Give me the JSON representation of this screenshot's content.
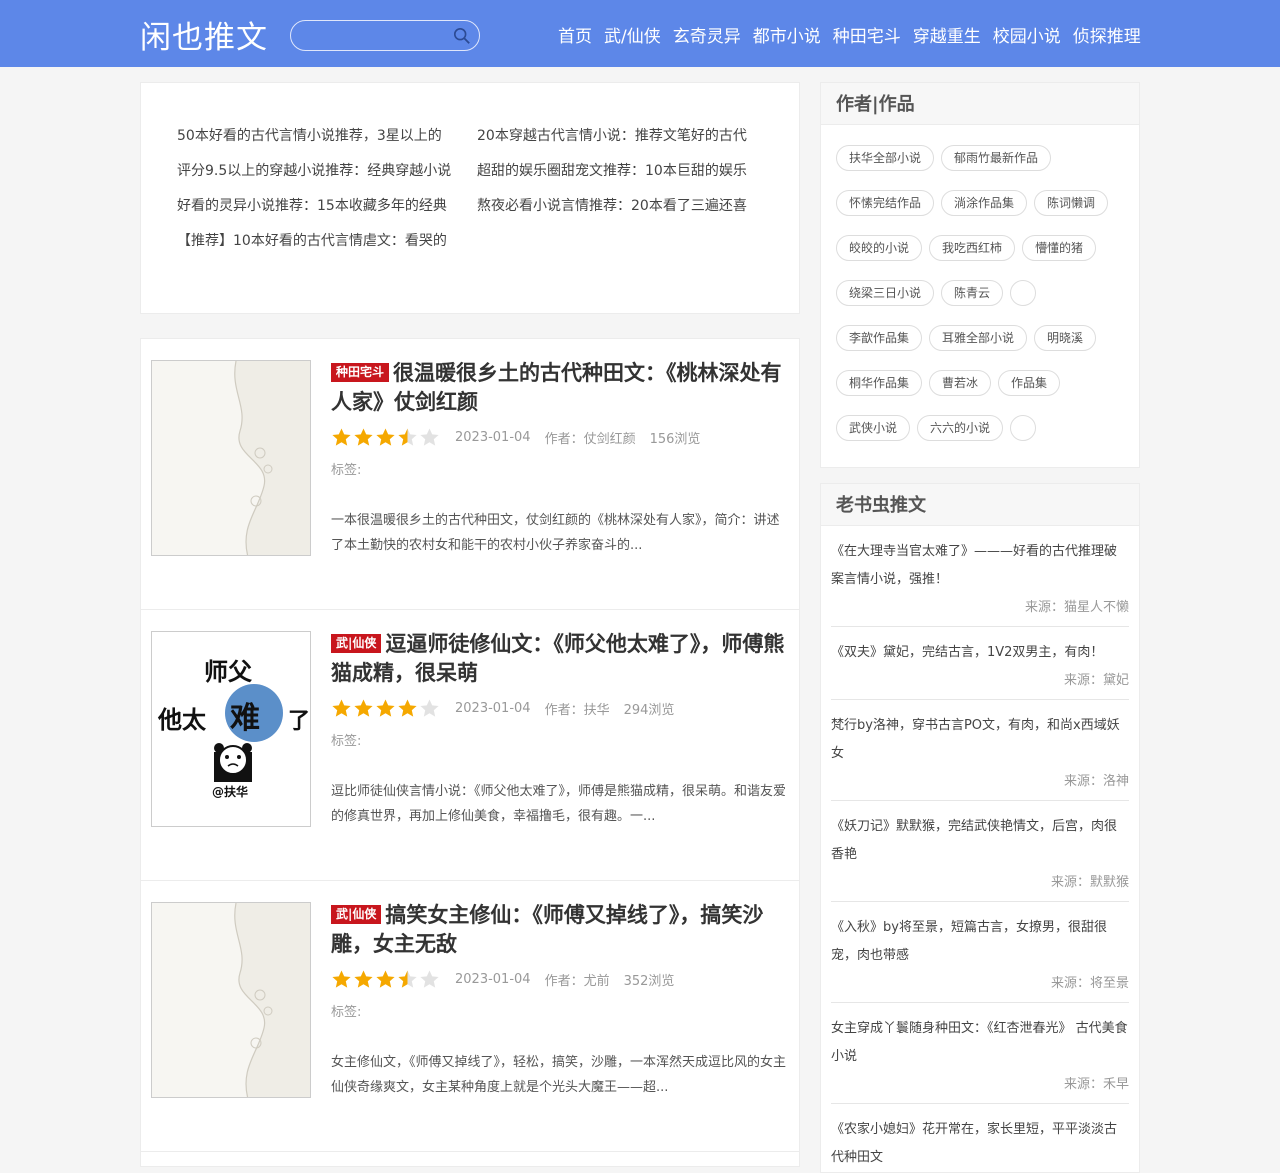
{
  "header": {
    "logo": "闲也推文",
    "nav": [
      "首页",
      "武/仙侠",
      "玄奇灵异",
      "都市小说",
      "种田宅斗",
      "穿越重生",
      "校园小说",
      "侦探推理"
    ]
  },
  "top_links": [
    "50本好看的古代言情小说推荐，3星以上的",
    "20本穿越古代言情小说：推荐文笔好的古代",
    "评分9.5以上的穿越小说推荐：经典穿越小说",
    "超甜的娱乐圈甜宠文推荐：10本巨甜的娱乐",
    "好看的灵异小说推荐：15本收藏多年的经典",
    "熬夜必看小说言情推荐：20本看了三遍还喜",
    "【推荐】10本好看的古代言情虐文：看哭的"
  ],
  "articles": [
    {
      "category": "种田宅斗",
      "title": "很温暖很乡土的古代种田文：《桃林深处有人家》仗剑红颜",
      "rating": 3.5,
      "date": "2023-01-04",
      "author": "作者：仗剑红颜",
      "views": "156浏览",
      "tags": "标签:",
      "excerpt": "一本很温暖很乡土的古代种田文，仗剑红颜的《桃林深处有人家》，简介：讲述了本土勤快的农村女和能干的农村小伙子养家奋斗的..."
    },
    {
      "category": "武|仙侠",
      "title": "逗逼师徒修仙文：《师父他太难了》，师傅熊猫成精，很呆萌",
      "rating": 4,
      "date": "2023-01-04",
      "author": "作者：扶华",
      "views": "294浏览",
      "tags": "标签:",
      "excerpt": "逗比师徒仙侠言情小说：《师父他太难了》，师傅是熊猫成精，很呆萌。和谐友爱的修真世界，再加上修仙美食，幸福撸毛，很有趣。一...",
      "cover": {
        "line1": "师父",
        "line2_a": "他太",
        "line2_b": "难",
        "line2_c": "了",
        "credit": "@扶华"
      }
    },
    {
      "category": "武|仙侠",
      "title": "搞笑女主修仙：《师傅又掉线了》，搞笑沙雕，女主无敌",
      "rating": 3.5,
      "date": "2023-01-04",
      "author": "作者：尤前",
      "views": "352浏览",
      "tags": "标签:",
      "excerpt": "女主修仙文，《师傅又掉线了》，轻松，搞笑，沙雕，一本浑然天成逗比风的女主仙侠奇缘爽文，女主某种角度上就是个光头大魔王——超..."
    }
  ],
  "sidebar": {
    "authors_title": "作者|作品",
    "authors": [
      "扶华全部小说",
      "郁雨竹最新作品",
      "怀愫完结作品",
      "淌涂作品集",
      "陈词懒调",
      "皎皎的小说",
      "我吃西红柿",
      "懵懂的猪",
      "绕梁三日小说",
      "陈青云",
      "",
      "李歆作品集",
      "耳雅全部小说",
      "明晓溪",
      "桐华作品集",
      "曹若冰",
      "作品集",
      "武侠小说",
      "六六的小说",
      ""
    ],
    "rec_title": "老书虫推文",
    "recs": [
      {
        "text": "《在大理寺当官太难了》———好看的古代推理破案言情小说，强推！",
        "source": "来源：猫星人不懒"
      },
      {
        "text": "《双夫》黛妃，完结古言，1V2双男主，有肉！",
        "source": "来源：黛妃"
      },
      {
        "text": "梵行by洛神，穿书古言PO文，有肉，和尚x西域妖女",
        "source": "来源：洛神"
      },
      {
        "text": "《妖刀记》默默猴，完结武侠艳情文，后宫，肉很香艳",
        "source": "来源：默默猴"
      },
      {
        "text": "《入秋》by将至景，短篇古言，女撩男，很甜很宠，肉也带感",
        "source": "来源：将至景"
      },
      {
        "text": "女主穿成丫鬟随身种田文：《红杏泄春光》 古代美食小说",
        "source": "来源：禾早"
      },
      {
        "text": "《农家小媳妇》花开常在，家长里短，平平淡淡古代种田文",
        "source": ""
      }
    ]
  },
  "colors": {
    "header": "#5d87e8",
    "category": "#c8161d",
    "star": "#f5a800"
  }
}
